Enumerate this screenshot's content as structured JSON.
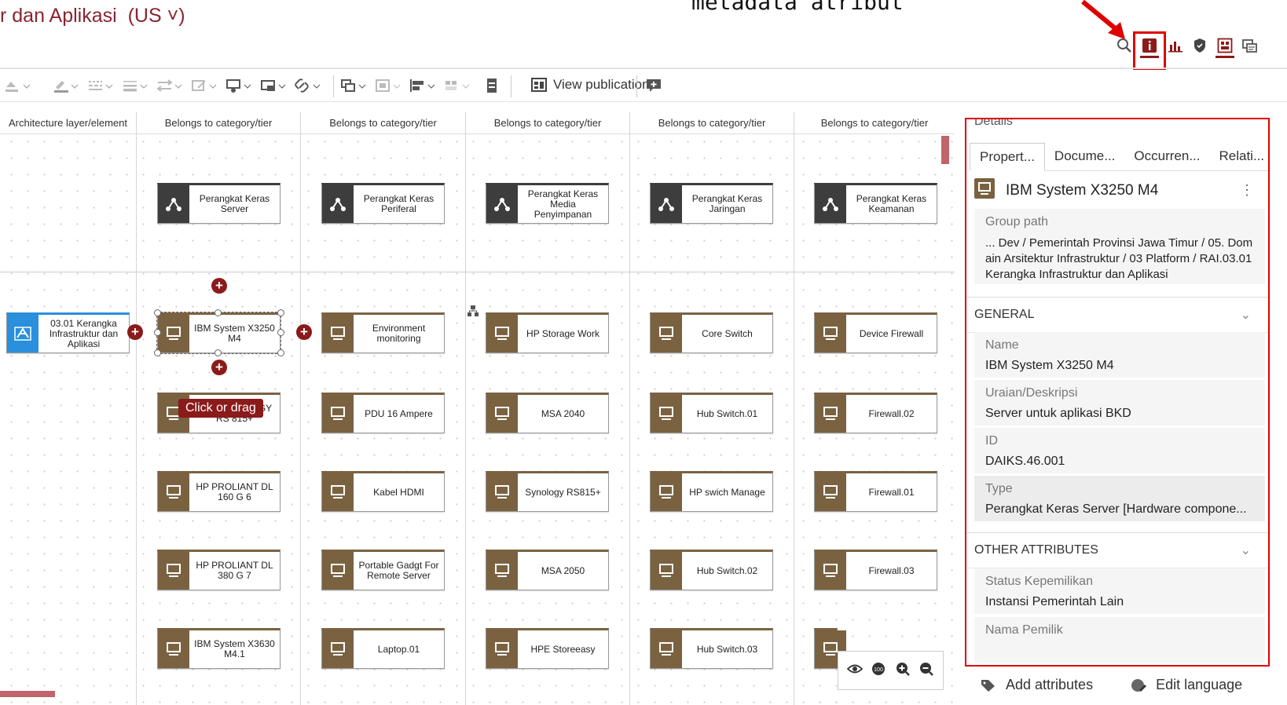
{
  "header": {
    "title": "r dan Aplikasi",
    "language": "(US ˅)",
    "annotation": "metadata atribut"
  },
  "top_icons": [
    "search-icon",
    "info-icon",
    "chart-icon",
    "shield-icon",
    "layout-icon",
    "window-icon"
  ],
  "toolbar": {
    "view_publication": "View publication"
  },
  "columns": [
    "Architecture layer/element",
    "Belongs to category/tier",
    "Belongs to category/tier",
    "Belongs to category/tier",
    "Belongs to category/tier",
    "Belongs to category/tier"
  ],
  "categories": [
    "Perangkat Keras Server",
    "Perangkat Keras Periferal",
    "Perangkat Keras Media Penyimpanan",
    "Perangkat Keras Jaringan",
    "Perangkat Keras Keamanan"
  ],
  "arch_node": "03.01 Kerangka Infrastruktur dan Aplikasi",
  "grid_rows": [
    [
      "IBM System X3250 M4",
      "Environment monitoring",
      "HP Storage Work",
      "Core Switch",
      "Device Firewall"
    ],
    [
      "NAS SYNOLOGY RS 815+",
      "PDU 16 Ampere",
      "MSA 2040",
      "Hub Switch.01",
      "Firewall.02"
    ],
    [
      "HP PROLIANT DL 160 G 6",
      "Kabel HDMI",
      "Synology RS815+",
      "HP swich Manage",
      "Firewall.01"
    ],
    [
      "HP PROLIANT DL 380 G 7",
      "Portable Gadgt For Remote Server",
      "MSA 2050",
      "Hub Switch.02",
      "Firewall.03"
    ],
    [
      "IBM System X3630 M4.1",
      "Laptop.01",
      "HPE Storeeasy",
      "Hub Switch.03",
      ""
    ]
  ],
  "tooltip": "Click or drag",
  "details": {
    "title": "Details",
    "tabs": [
      "Propert...",
      "Docume...",
      "Occurren...",
      "Relati..."
    ],
    "object_name": "IBM System X3250 M4",
    "group_path_label": "Group path",
    "group_path": "... Dev / Pemerintah Provinsi Jawa Timur / 05. Domain Arsitektur Infrastruktur / 03 Platform / RAI.03.01 Kerangka Infrastruktur dan Aplikasi",
    "general_label": "GENERAL",
    "fields": [
      {
        "label": "Name",
        "value": "IBM System X3250 M4"
      },
      {
        "label": "Uraian/Deskripsi",
        "value": "Server untuk aplikasi BKD"
      },
      {
        "label": "ID",
        "value": "DAIKS.46.001"
      },
      {
        "label": "Type",
        "value": "Perangkat Keras Server [Hardware compone..."
      }
    ],
    "other_label": "OTHER ATTRIBUTES",
    "other_fields": [
      {
        "label": "Status Kepemilikan",
        "value": "Instansi Pemerintah Lain"
      },
      {
        "label": "Nama Pemilik",
        "value": ""
      }
    ],
    "add_attributes": "Add attributes",
    "edit_language": "Edit language"
  },
  "colors": {
    "accent": "#8b1a1a",
    "hardware": "#7a6241",
    "category": "#3d3d3d",
    "architecture": "#2a8fdc",
    "highlight": "#e00000"
  }
}
